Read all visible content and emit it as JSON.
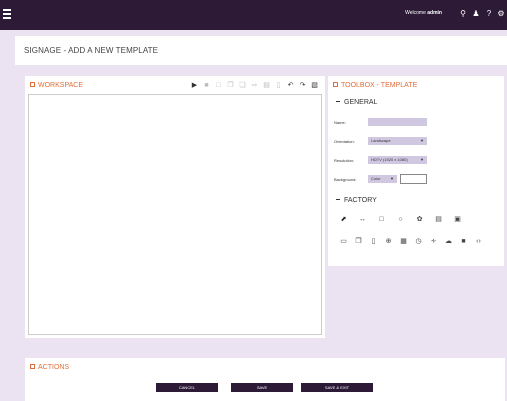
{
  "topbar": {
    "welcome_prefix": "Welcome",
    "username": "admin",
    "icons": [
      "search-icon",
      "user-icon",
      "help-icon",
      "settings-icon"
    ]
  },
  "page": {
    "title": "SIGNAGE - ADD A NEW TEMPLATE"
  },
  "workspace": {
    "title": "WORKSPACE",
    "toolbar_icons": [
      "play-icon",
      "stop-icon",
      "save-icon",
      "copy-icon",
      "paste-icon",
      "export-icon",
      "clipboard-icon",
      "document-icon",
      "undo-icon",
      "redo-icon",
      "trash-icon"
    ]
  },
  "toolbox": {
    "title": "TOOLBOX - TEMPLATE",
    "general": {
      "heading": "GENERAL",
      "name_label": "Name:",
      "name_value": "",
      "orientation_label": "Orientation:",
      "orientation_value": "Landscape",
      "resolution_label": "Resolution:",
      "resolution_value": "HDTV (1920 x 1080)",
      "background_label": "Background:",
      "background_value": "Color"
    },
    "factory": {
      "heading": "FACTORY",
      "row1": [
        "pointer-icon",
        "line-icon",
        "rectangle-icon",
        "circle-icon",
        "shape-icon",
        "text-icon",
        "image-icon"
      ],
      "row2": [
        "video-icon",
        "slideshow-icon",
        "document-icon",
        "web-icon",
        "calendar-icon",
        "clock-icon",
        "rss-icon",
        "weather-icon",
        "media-icon",
        "code-icon"
      ]
    }
  },
  "actions": {
    "title": "ACTIONS",
    "cancel_label": "CANCEL",
    "save_label": "SAVE",
    "save_exit_label": "SAVE & EXIT"
  },
  "colors": {
    "topbar": "#2c1a36",
    "background": "#ebe3f2",
    "accent": "#e06e3a",
    "field": "#cfc8e0"
  }
}
